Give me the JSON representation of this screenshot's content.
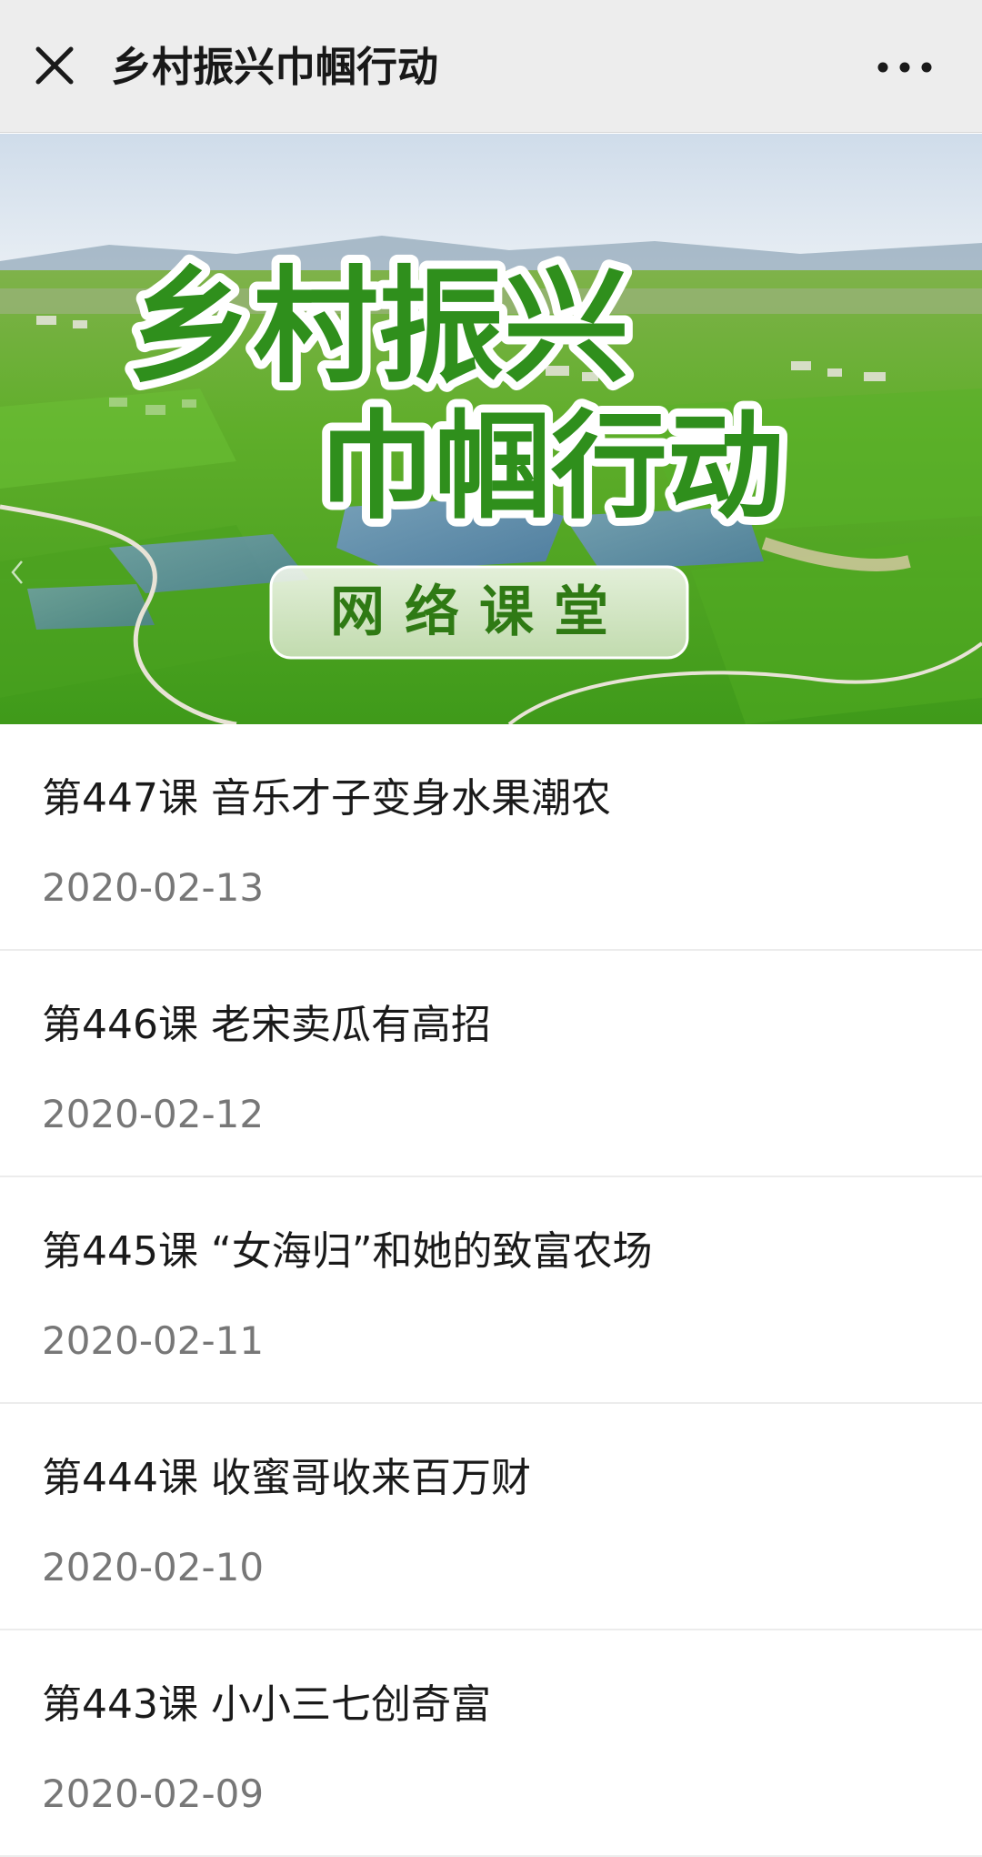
{
  "header": {
    "title": "乡村振兴巾帼行动",
    "close_icon": "close-icon",
    "more_icon": "more-horizontal-icon"
  },
  "banner": {
    "title_line1": "乡村振兴",
    "title_line2": "巾帼行动",
    "badge": "网络课堂",
    "title_color": "#2f8f1c",
    "scene": "aerial view of green rice fields and ponds with villages"
  },
  "lessons": [
    {
      "title": "第447课 音乐才子变身水果潮农",
      "date": "2020-02-13"
    },
    {
      "title": "第446课 老宋卖瓜有高招",
      "date": "2020-02-12"
    },
    {
      "title": "第445课 “女海归”和她的致富农场",
      "date": "2020-02-11"
    },
    {
      "title": "第444课 收蜜哥收来百万财",
      "date": "2020-02-10"
    },
    {
      "title": "第443课 小小三七创奇富",
      "date": "2020-02-09"
    }
  ]
}
